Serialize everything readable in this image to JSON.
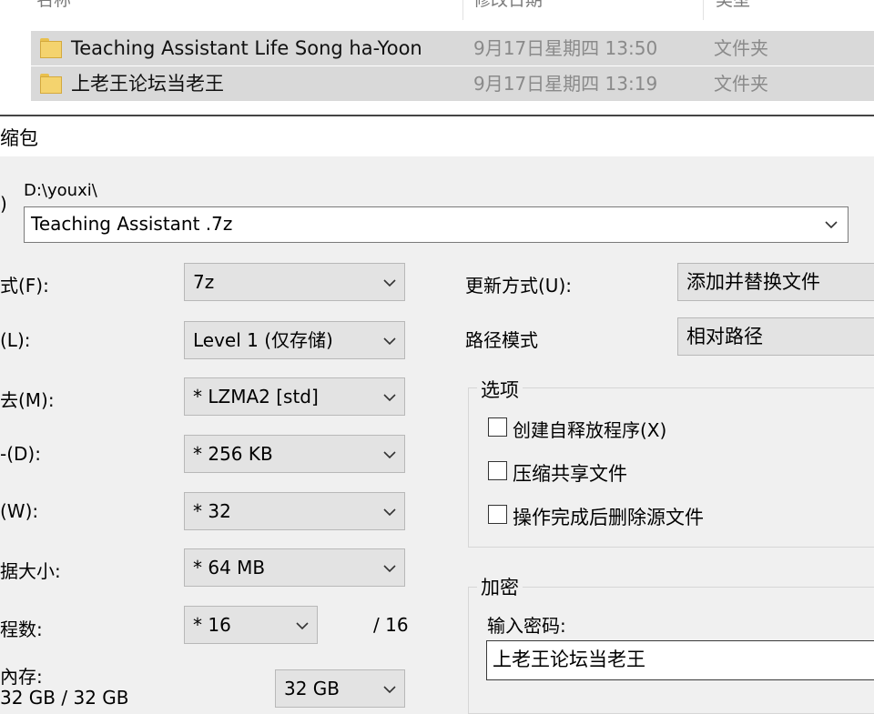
{
  "explorer": {
    "columns": {
      "name": "名称",
      "modified": "修改日期",
      "type": "类型"
    },
    "files": [
      {
        "name": "Teaching Assistant Life Song ha-Yoon",
        "modified": "9月17日星期四 13:50",
        "type": "文件夹"
      },
      {
        "name": "上老王论坛当老王",
        "modified": "9月17日星期四 13:19",
        "type": "文件夹"
      }
    ]
  },
  "dialog": {
    "title": "缩包",
    "archive_label": ")",
    "archive_path": "D:\\youxi\\",
    "archive_name": "Teaching Assistant .7z",
    "left": {
      "format": {
        "label": "式(F):",
        "value": "7z"
      },
      "level": {
        "label": "(L):",
        "value": "Level 1 (仅存储)"
      },
      "method": {
        "label": "去(M):",
        "value": "* LZMA2 [std]"
      },
      "dict": {
        "label": "-(D):",
        "value": "* 256 KB"
      },
      "word": {
        "label": "(W):",
        "value": "* 32"
      },
      "solid": {
        "label": "据大小:",
        "value": "* 64 MB"
      },
      "threads": {
        "label": "程数:",
        "value": "* 16",
        "max": "/ 16"
      },
      "memory": {
        "label": "內存:",
        "usage": "32 GB / 32 GB",
        "value": "32 GB"
      }
    },
    "right": {
      "update": {
        "label": "更新方式(U):",
        "value": "添加并替换文件"
      },
      "path": {
        "label": "路径模式",
        "value": "相对路径"
      },
      "options": {
        "title": "选项",
        "items": [
          "创建自释放程序(X)",
          "压缩共享文件",
          "操作完成后删除源文件"
        ]
      },
      "encryption": {
        "title": "加密",
        "password_label": "输入密码:",
        "password_value": "上老王论坛当老王"
      }
    }
  }
}
